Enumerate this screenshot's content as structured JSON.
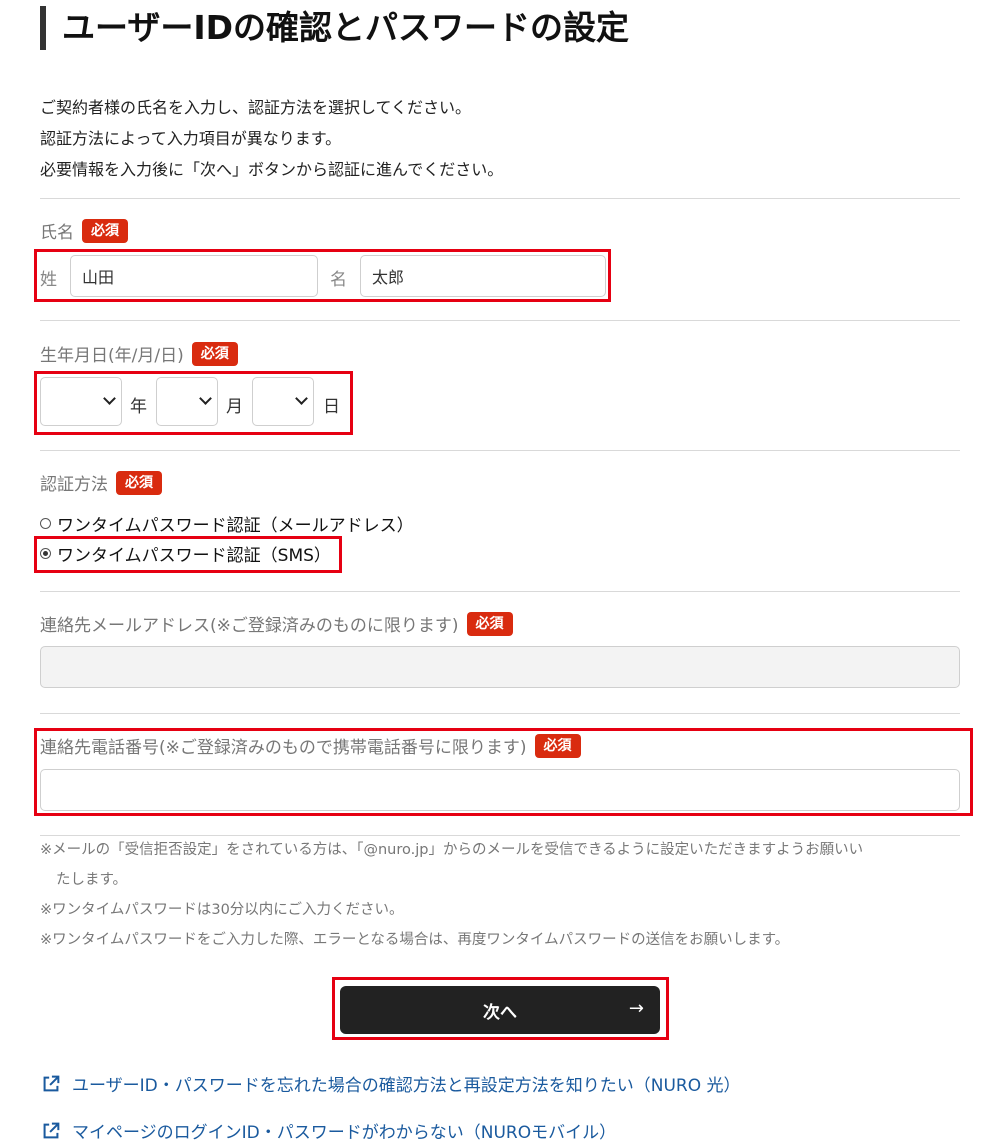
{
  "page_title": "ユーザーIDの確認とパスワードの設定",
  "intro": [
    "ご契約者様の氏名を入力し、認証方法を選択してください。",
    "認証方法によって入力項目が異なります。",
    "必要情報を入力後に「次へ」ボタンから認証に進んでください。"
  ],
  "required_badge": "必須",
  "name_section": {
    "label": "氏名",
    "last_prefix": "姓",
    "last_value": "山田",
    "first_prefix": "名",
    "first_value": "太郎"
  },
  "birth_section": {
    "label": "生年月日(年/月/日)",
    "year_unit": "年",
    "month_unit": "月",
    "day_unit": "日"
  },
  "auth_section": {
    "label": "認証方法",
    "options": [
      {
        "label": "ワンタイムパスワード認証（メールアドレス）",
        "checked": false
      },
      {
        "label": "ワンタイムパスワード認証（SMS）",
        "checked": true
      }
    ]
  },
  "email_section": {
    "label": "連絡先メールアドレス(※ご登録済みのものに限ります)",
    "value": ""
  },
  "phone_section": {
    "label": "連絡先電話番号(※ご登録済みのもので携帯電話番号に限ります)",
    "value": ""
  },
  "notes": [
    "※メールの「受信拒否設定」をされている方は、「@nuro.jp」からのメールを受信できるように設定いただきますようお願いい",
    "たします。",
    "※ワンタイムパスワードは30分以内にご入力ください。",
    "※ワンタイムパスワードをご入力した際、エラーとなる場合は、再度ワンタイムパスワードの送信をお願いします。"
  ],
  "next_button": {
    "label": "次へ",
    "arrow": "→"
  },
  "links": [
    "ユーザーID・パスワードを忘れた場合の確認方法と再設定方法を知りたい（NURO 光）",
    "マイページのログインID・パスワードがわからない（NUROモバイル）"
  ],
  "colors": {
    "accent_red": "#e60012",
    "badge_red": "#d92b0f",
    "link_blue": "#1a5a9e",
    "button_dark": "#222222"
  }
}
